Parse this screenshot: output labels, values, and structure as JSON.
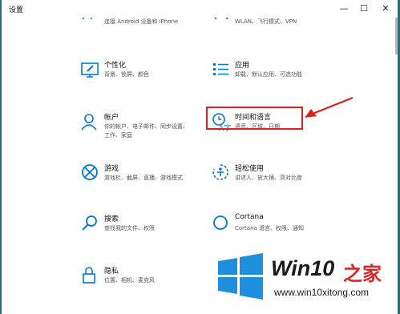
{
  "window": {
    "title": "设置",
    "controls": [
      "—",
      "☐",
      "✕"
    ]
  },
  "top_partial": {
    "left_desc": "连接 Android 设备和 iPhone",
    "right_desc": "WLAN、飞行模式、VPN"
  },
  "items": [
    {
      "title": "个性化",
      "desc": "背景、锁屏、颜色",
      "icon": "personalization-icon"
    },
    {
      "title": "应用",
      "desc": "卸载、默认应用、可选功能",
      "icon": "apps-icon"
    },
    {
      "title": "帐户",
      "desc": "你的帐户、电子邮件、同步设置、工作、家庭",
      "desc1": "你的帐户、电子邮件、同步设置、",
      "desc2": "工作、家庭",
      "icon": "account-icon"
    },
    {
      "title": "时间和语言",
      "desc": "语音、区域、日期",
      "icon": "time-language-icon"
    },
    {
      "title": "游戏",
      "desc": "游戏栏、截屏、直播、游戏模式",
      "icon": "xbox-icon"
    },
    {
      "title": "轻松使用",
      "desc": "讲述人、放大镜、高对比度",
      "icon": "ease-of-access-icon"
    },
    {
      "title": "搜索",
      "desc": "查找我的文件、权限",
      "icon": "search-icon"
    },
    {
      "title": "Cortana",
      "desc": "Cortana 语言、权限、通知",
      "icon": "cortana-icon"
    },
    {
      "title": "隐私",
      "desc": "位置、相机、麦克风",
      "icon": "lock-icon"
    }
  ],
  "watermark": {
    "brand": "Win10",
    "brand_suffix": "之家",
    "url": "www.win10xitong.com",
    "colors": {
      "logo_blue": "#1e8fdc",
      "brand_red": "#d42a2a",
      "text_dark": "#1a1a1a"
    }
  },
  "annotation": {
    "highlight_color": "#e02020"
  },
  "colors": {
    "accent": "#0078d7",
    "frame": "#2c6f72"
  }
}
